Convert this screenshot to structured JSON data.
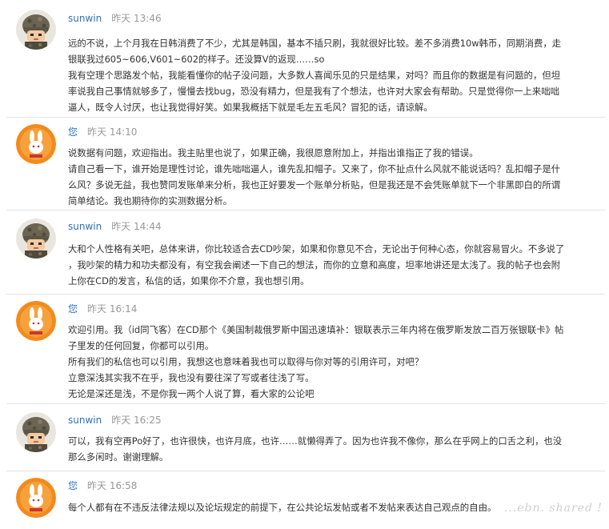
{
  "messages": [
    {
      "user": "sunwin",
      "time": "昨天 13:46",
      "avatar": "soldier-avatar",
      "lines": [
        "远的不说，上个月我在日韩消费了不少，尤其是韩国，基本不插只刷，我就很好比较。差不多消费10w韩币，同期消费，走",
        "银联我过605~606,V601~602的样子。还没算V的返现……so",
        "我有空理个思路发个帖，我能看懂你的帖子没问题，大多数人喜闻乐见的只是结果，对吗？而且你的数据是有问题的，但坦",
        "率说我自己事情就够多了，慢慢去找bug，恐没有精力，但是我有了个想法，也许对大家会有帮助。只是觉得你一上来咄咄",
        "逼人，既令人讨厌，也让我觉得好笑。如果我概括下就是毛左五毛风？冒犯的话，请谅解。"
      ]
    },
    {
      "user": "您",
      "time": "昨天 14:10",
      "avatar": "rabbit-avatar",
      "lines": [
        "说数据有问题，欢迎指出。我主贴里也说了，如果正确，我很愿意附加上，并指出谁指正了我的错误。",
        "请自己看一下，谁开始是理性讨论，谁先咄咄逼人，谁先乱扣帽子。又来了，你不扯点什么风就不能说话吗？乱扣帽子是什",
        "么风？多说无益，我也赞同发账单来分析，我也正好要发一个账单分析贴，但是我还是不会凭账单就下一个非黑即白的所谓",
        "简单结论。我也期待你的实测数据分析。"
      ]
    },
    {
      "user": "sunwin",
      "time": "昨天 14:44",
      "avatar": "soldier-avatar",
      "lines": [
        "大和个人性格有关吧，总体来讲，你比较适合去CD吵架，如果和你意见不合，无论出于何种心态，你就容易冒火。不多说了",
        "，我吵架的精力和功夫都没有，有空我会阐述一下自己的想法，而你的立意和高度，坦率地讲还是太浅了。我的帖子也会附",
        "上你在CD的发言，私信的话，如果你不介意，我也想引用。"
      ]
    },
    {
      "user": "您",
      "time": "昨天 16:14",
      "avatar": "rabbit-avatar",
      "lines": [
        "欢迎引用。我（id同飞客）在CD那个《美国制裁俄罗斯中国迅速填补：银联表示三年内将在俄罗斯发放二百万张银联卡》帖",
        "子里发的任何回复，你都可以引用。",
        "所有我们的私信也可以引用，我想这也意味着我也可以取得与你对等的引用许可，对吧？",
        "立意深浅其实我不在乎，我也没有要往深了写或者往浅了写。",
        "无论是深还是浅，不是你我一两个人说了算，看大家的公论吧"
      ]
    },
    {
      "user": "sunwin",
      "time": "昨天 16:25",
      "avatar": "soldier-avatar",
      "lines": [
        "可以，我有空再Po好了，也许很快，也许月底，也许……就懒得弄了。因为也许我不像你，那么在乎网上的口舌之利，也没",
        "那么多闲时。谢谢理解。"
      ]
    },
    {
      "user": "您",
      "time": "昨天 16:58",
      "avatar": "rabbit-avatar",
      "lines": [
        "每个人都有在不违反法律法规以及论坛规定的前提下，在公共论坛发帖或者不发帖来表达自己观点的自由。"
      ]
    }
  ],
  "watermark": "...ebn. shared !",
  "colors": {
    "username": "#2f6fbf",
    "time": "#999999",
    "text": "#333333",
    "separator": "#e3e3e3",
    "rabbit_bg": "#f28a1e",
    "soldier_helmet": "#6b6452"
  }
}
